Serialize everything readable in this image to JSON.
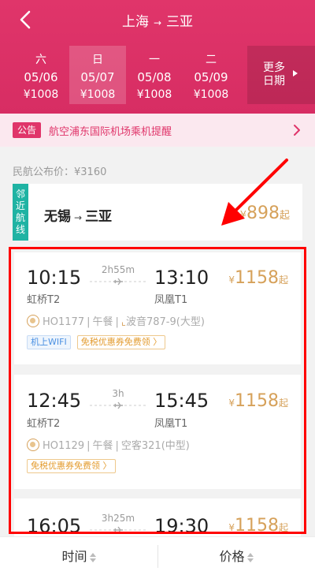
{
  "header": {
    "from": "上海",
    "to": "三亚",
    "arrow": "→"
  },
  "dates": [
    {
      "weekday": "六",
      "date": "05/06",
      "price": "¥1008"
    },
    {
      "weekday": "日",
      "date": "05/07",
      "price": "¥1008"
    },
    {
      "weekday": "一",
      "date": "05/08",
      "price": "¥1008"
    },
    {
      "weekday": "二",
      "date": "05/09",
      "price": "¥1008"
    }
  ],
  "more_dates": {
    "line1": "更多",
    "line2": "日期"
  },
  "notice": {
    "badge": "公告",
    "text": "航空浦东国际机场乘机提醒"
  },
  "official_price": "民航公布价：¥3160",
  "nearby": {
    "tag": "邻近航线",
    "from": "无锡",
    "to": "三亚",
    "arrow": "→",
    "currency": "¥",
    "price": "898",
    "suffix": "起"
  },
  "flights": [
    {
      "dep_time": "10:15",
      "dep_airport": "虹桥T2",
      "duration": "2h55m",
      "arr_time": "13:10",
      "arr_airport": "凤凰T1",
      "currency": "¥",
      "price": "1158",
      "suffix": "起",
      "flight_no": "HO1177",
      "meal": "午餐",
      "aircraft": "波音787-9(大型)",
      "tags": [
        "机上WIFI",
        "免税优惠券免费领 〉"
      ]
    },
    {
      "dep_time": "12:45",
      "dep_airport": "虹桥T2",
      "duration": "3h",
      "arr_time": "15:45",
      "arr_airport": "凤凰T1",
      "currency": "¥",
      "price": "1158",
      "suffix": "起",
      "flight_no": "HO1129",
      "meal": "午餐",
      "aircraft": "空客321(中型)",
      "tags": [
        "免税优惠券免费领 〉"
      ]
    },
    {
      "dep_time": "16:05",
      "duration": "3h25m",
      "arr_time": "19:30",
      "currency": "¥",
      "price": "1158",
      "suffix": "起"
    }
  ],
  "bottom": {
    "time_label": "时间",
    "price_label": "价格"
  },
  "colors": {
    "brand": "#e0356a",
    "price": "#d6a15a",
    "highlight": "#ff0000",
    "nearby_tag": "#1fb3a3"
  }
}
